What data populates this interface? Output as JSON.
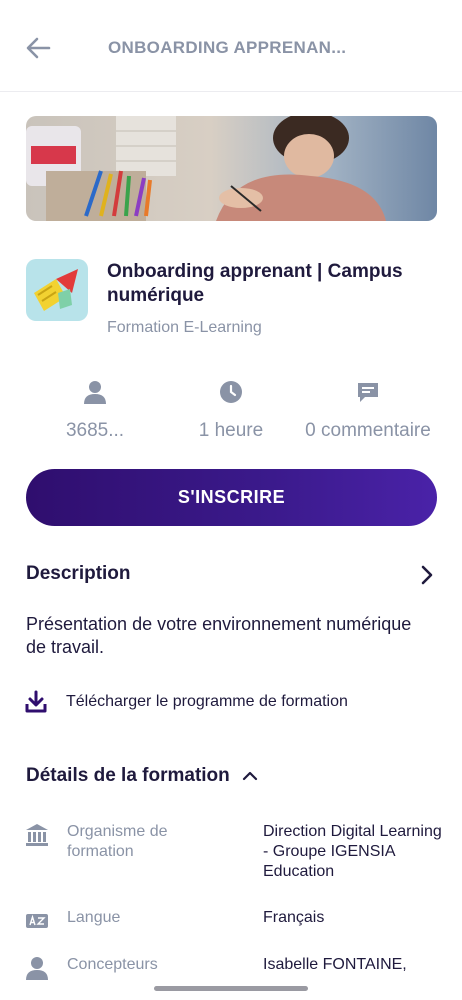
{
  "header": {
    "title": "ONBOARDING APPRENAN..."
  },
  "course": {
    "title": "Onboarding apprenant | Campus numérique",
    "type": "Formation E-Learning"
  },
  "stats": {
    "users": "3685...",
    "duration": "1 heure",
    "comments": "0 commentaire"
  },
  "cta_label": "S'INSCRIRE",
  "description": {
    "heading": "Description",
    "text": "Présentation de votre environnement numérique de travail."
  },
  "download_label": "Télécharger le programme de formation",
  "details": {
    "heading": "Détails de la formation",
    "rows": [
      {
        "label": "Organisme de formation",
        "value": "Direction Digital Learning - Groupe IGENSIA Education"
      },
      {
        "label": "Langue",
        "value": "Français"
      },
      {
        "label": "Concepteurs",
        "value": "Isabelle FONTAINE,"
      }
    ]
  },
  "icons": {
    "back": "arrow-left-icon",
    "users": "user-icon",
    "duration": "clock-icon",
    "comments": "comment-icon",
    "description_more": "chevron-right-icon",
    "download": "download-icon",
    "details_toggle": "chevron-up-icon",
    "organisation": "institution-icon",
    "language": "language-icon",
    "designers": "user-icon"
  },
  "colors": {
    "primary": "#2f0e6e",
    "text": "#1f1a3d",
    "muted": "#8a93a6"
  }
}
